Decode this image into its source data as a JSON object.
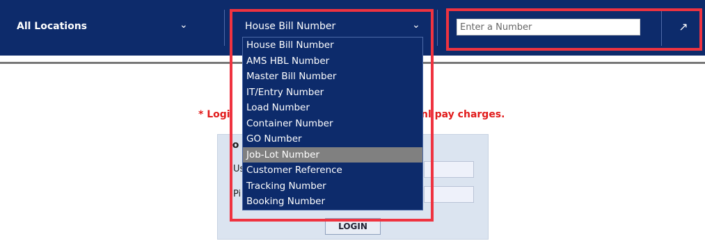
{
  "topbar": {
    "location_label": "All Locations",
    "location_chevron_icon": "chevron-down-icon",
    "search_type_label": "House Bill Number",
    "search_type_chevron_icon": "chevron-down-icon",
    "number_placeholder": "Enter a Number",
    "go_icon": "arrow-up-right-icon",
    "bar_color": "#0d2b6b"
  },
  "dropdown": {
    "selected_index": 7,
    "options": [
      "House Bill Number",
      "AMS HBL Number",
      "Master Bill Number",
      "IT/Entry Number",
      "Load Number",
      "Container Number",
      "GO Number",
      "Job-Lot Number",
      "Customer Reference",
      "Tracking Number",
      "Booking Number"
    ],
    "highlight_color": "#808080"
  },
  "notice": {
    "text_left": "* Logi",
    "text_right": "nl pay charges.",
    "color": "#e11b1b"
  },
  "login": {
    "title": "lo",
    "username_label": "Us",
    "password_label": "Pi",
    "button_label": "LOGIN"
  },
  "annotation": {
    "color": "#ef3340"
  }
}
